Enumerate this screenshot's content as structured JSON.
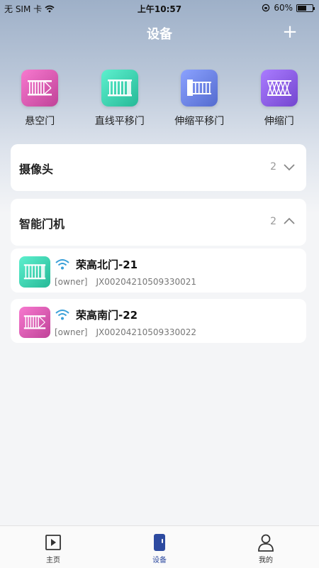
{
  "status_bar": {
    "carrier": "无 SIM 卡",
    "time": "上午10:57",
    "battery_percent": "60%",
    "battery_level": 0.6
  },
  "header": {
    "title": "设备",
    "add_label": "+"
  },
  "categories": [
    {
      "label": "悬空门",
      "icon": "cantilever-gate-icon",
      "color": "#d95bb1"
    },
    {
      "label": "直线平移门",
      "icon": "sliding-gate-icon",
      "color": "#3fd2b0"
    },
    {
      "label": "伸缩平移门",
      "icon": "telescopic-sliding-gate-icon",
      "color": "#6d84e8"
    },
    {
      "label": "伸缩门",
      "icon": "retractable-gate-icon",
      "color": "#8c5ee8"
    }
  ],
  "sections": {
    "camera": {
      "title": "摄像头",
      "count": "2",
      "expanded": false
    },
    "smart_gate": {
      "title": "智能门机",
      "count": "2",
      "expanded": true
    }
  },
  "devices": [
    {
      "name": "荣高北门-21",
      "role": "[owner]",
      "serial": "JX00204210509330021"
    },
    {
      "name": "荣高南门-22",
      "role": "[owner]",
      "serial": "JX00204210509330022"
    }
  ],
  "tabbar": {
    "home": "主页",
    "devices": "设备",
    "mine": "我的"
  },
  "colors": {
    "accent": "#2d4aa0",
    "wifi": "#3aa0d8"
  }
}
